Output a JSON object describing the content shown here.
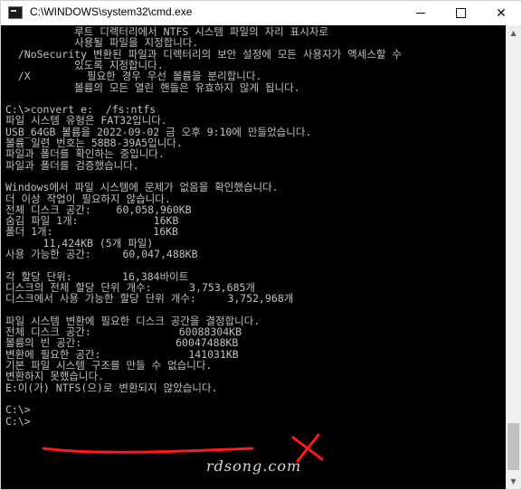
{
  "window": {
    "title": "C:\\WINDOWS\\system32\\cmd.exe",
    "minimize_label": "",
    "maximize_label": "",
    "close_label": "✕"
  },
  "console": {
    "lines": [
      "           루트 디렉터리에서 NTFS 시스템 파일의 자리 표시자로",
      "           사용될 파일을 지정합니다.",
      "  /NoSecurity 변환된 파일과 디렉터리의 보안 설정에 모든 사용자가 액세스할 수",
      "           있도록 지정합니다.",
      "  /X         필요한 경우 우선 볼륨을 분리합니다.",
      "           볼륨의 모든 열린 핸들은 유효하지 않게 됩니다.",
      "",
      "C:\\>convert e:  /fs:ntfs",
      "파일 시스템 유형은 FAT32입니다.",
      "USB_64GB 볼륨을 2022-09-02 금 오후 9:10에 만들었습니다.",
      "볼륨 일련 번호는 58B8-39A5입니다.",
      "파일과 폴더를 확인하는 중입니다.",
      "파일과 폴더를 검증했습니다.",
      "",
      "Windows에서 파일 시스템에 문제가 없음을 확인했습니다.",
      "더 이상 작업이 필요하지 않습니다.",
      "전체 디스크 공간:    60,058,960KB",
      "숨김 파일 1개:            16KB",
      "폴더 1개:                16KB",
      "      11,424KB (5개 파일)",
      "사용 가능한 공간:     60,047,488KB",
      "",
      "각 할당 단위:        16,384바이트",
      "디스크의 전체 할당 단위 개수:      3,753,685개",
      "디스크에서 사용 가능한 할당 단위 개수:     3,752,968개",
      "",
      "파일 시스템 변환에 필요한 디스크 공간을 결정합니다.",
      "전체 디스크 공간:              60088304KB",
      "볼륨의 빈 공간:               60047488KB",
      "변환에 필요한 공간:              141031KB",
      "기본 파일 시스템 구조를 만들 수 없습니다.",
      "변환하지 못했습니다.",
      "E:이(가) NTFS(으)로 변환되지 않았습니다.",
      "",
      "C:\\>",
      "C:\\>"
    ]
  },
  "scrollbar": {
    "up_arrow": "▲",
    "down_arrow": "▼"
  },
  "annotation": {
    "underline_color": "#ff1a1a",
    "cross_color": "#ff1a1a"
  },
  "watermark": {
    "text": "rdsong.com"
  }
}
